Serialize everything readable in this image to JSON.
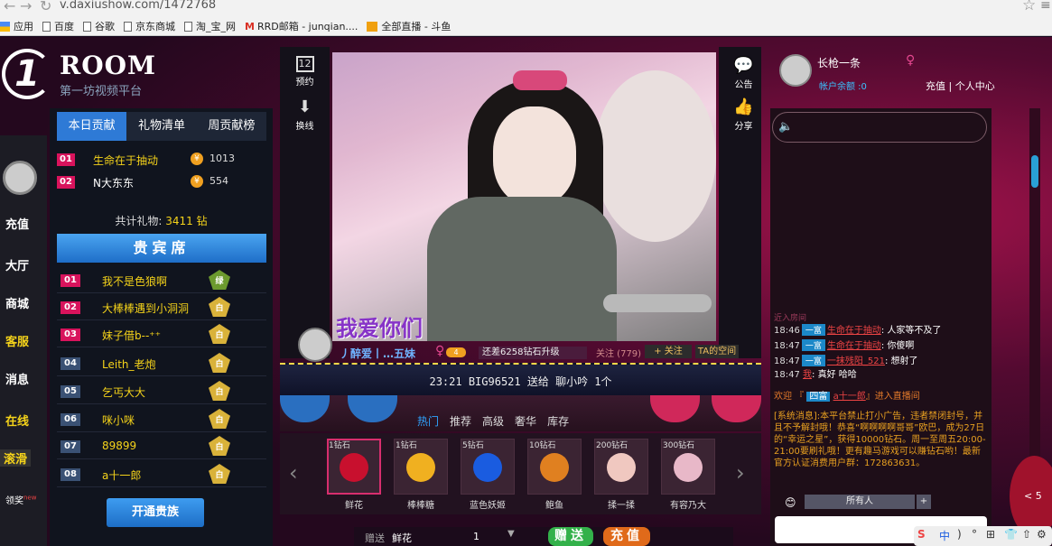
{
  "browser": {
    "url": "v.daxiushow.com/1472768",
    "bookmarks": [
      "应用",
      "百度",
      "谷歌",
      "京东商城",
      "淘_宝_网",
      "RRD邮箱 - junqian....",
      "全部直播 - 斗鱼"
    ]
  },
  "logo": {
    "title": "ROOM",
    "subtitle": "第一坊视频平台",
    "mark": "1"
  },
  "left_nav": {
    "items": [
      "充值",
      "大厅",
      "商城",
      "客服",
      "消息",
      "在线",
      "滚滑",
      "领奖"
    ],
    "badge": "new"
  },
  "left_panel": {
    "tabs": [
      "本日贡献",
      "礼物清单",
      "周贡献榜"
    ],
    "rank": [
      {
        "no": "01",
        "name": "生命在于抽动",
        "value": "1013"
      },
      {
        "no": "02",
        "name": "N大东东",
        "value": "554"
      }
    ],
    "total_label": "共计礼物:",
    "total_value": "3411 钻",
    "vip_title": "贵宾席",
    "vip": [
      {
        "no": "01",
        "name": "我不是色狼啊",
        "badge": "绿"
      },
      {
        "no": "02",
        "name": "大棒棒遇到小洞洞",
        "badge": "白"
      },
      {
        "no": "03",
        "name": "妹子借b--⁺⁺",
        "badge": "白"
      },
      {
        "no": "04",
        "name": "Leith_老炮",
        "badge": "白"
      },
      {
        "no": "05",
        "name": "乞丐大大",
        "badge": "白"
      },
      {
        "no": "06",
        "name": "咪小咪",
        "badge": "白"
      },
      {
        "no": "07",
        "name": "89899",
        "badge": "白"
      },
      {
        "no": "08",
        "name": "a十一郎",
        "badge": "白"
      }
    ],
    "open_vip": "开通贵族"
  },
  "video_tools": {
    "left": [
      {
        "icon": "calendar-icon",
        "label": "预约"
      },
      {
        "icon": "arrow-down-icon",
        "label": "换线"
      }
    ],
    "right": [
      {
        "icon": "speech-icon",
        "label": "公告"
      },
      {
        "icon": "thumbs-up-icon",
        "label": "分享"
      }
    ],
    "calendar_day": "12"
  },
  "video": {
    "overlay_text": "我爱你们"
  },
  "anchor": {
    "name": "丿醉爱丨…五妹",
    "level": "4",
    "diff": "还差6258钻石升级",
    "follow": "关注 (779)",
    "follow_btn": "+ 关注",
    "space_btn": "TA的空间"
  },
  "broadcast": "23:21  BIG96521 送给 聊小吟   1个",
  "gift_tabs": [
    "热门",
    "推荐",
    "高级",
    "奢华",
    "库存"
  ],
  "gifts": [
    {
      "price": "1钻石",
      "name": "鲜花",
      "color": "#c8102e"
    },
    {
      "price": "1钻石",
      "name": "棒棒糖",
      "color": "#f0b020"
    },
    {
      "price": "5钻石",
      "name": "蓝色妖姬",
      "color": "#1a5ce0"
    },
    {
      "price": "10钻石",
      "name": "鲍鱼",
      "color": "#e08020"
    },
    {
      "price": "200钻石",
      "name": "揉一揉",
      "color": "#f0c8c0"
    },
    {
      "price": "300钻石",
      "name": "有容乃大",
      "color": "#e8b8c8"
    }
  ],
  "send": {
    "label": "赠送",
    "gift": "鲜花",
    "qty": "1",
    "send_btn": "赠送",
    "charge_btn": "充值"
  },
  "user": {
    "name": "长枪一条",
    "balance": "帐户余额 :0",
    "links": "充值 | 个人中心"
  },
  "chat": {
    "section": "近入房间",
    "messages": [
      {
        "time": "18:46",
        "tag": "一富",
        "user": "生命在于抽动",
        "text": "人家等不及了"
      },
      {
        "time": "18:47",
        "tag": "一富",
        "user": "生命在于抽动",
        "text": "你傻啊"
      },
      {
        "time": "18:47",
        "tag": "一富",
        "user": "一抹残阳_521",
        "text": "想射了"
      },
      {
        "time": "18:47",
        "tag": "",
        "user": "我",
        "text": "真好 哈哈"
      }
    ],
    "welcome_prefix": "欢迎 『",
    "welcome_tag": "四富",
    "welcome_user": "a十一郎",
    "welcome_suffix": "』进入直播间",
    "system": "[系统消息]:本平台禁止打小广告，违者禁闭封号，并且不予解封哦！恭喜“啊啊啊啊哥哥”欧巴，成为27日的“幸运之星”，获得10000钻石。周一至周五20:00-21:00要刷礼哦！更有趣马游戏可以赚钻石哟！最新官方认证消费用户群：172863631。",
    "to": "所有人"
  },
  "side_tab": "< 5",
  "ime": [
    "S",
    "中",
    ")",
    "°",
    "⊞",
    "👕",
    "⇧",
    "⚙"
  ]
}
